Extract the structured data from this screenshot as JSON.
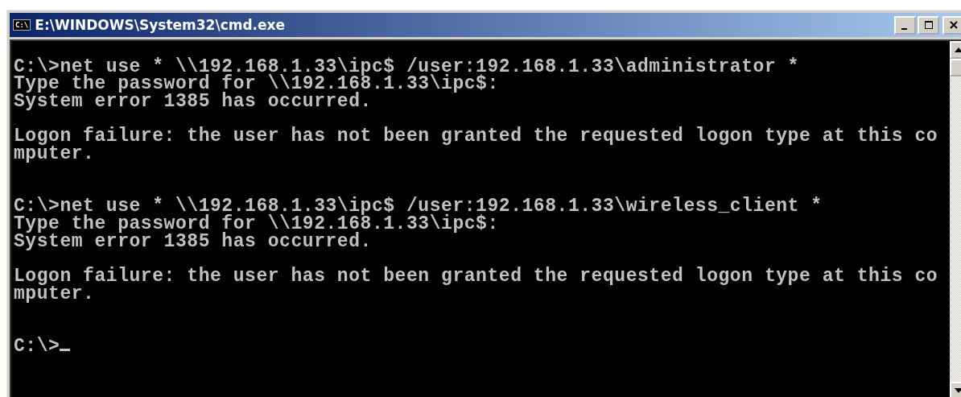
{
  "window": {
    "title": "E:\\WINDOWS\\System32\\cmd.exe",
    "icon_text": "C:\\"
  },
  "console": {
    "blocks": [
      {
        "kind": "command",
        "lines": [
          "C:\\>net use * \\\\192.168.1.33\\ipc$ /user:192.168.1.33\\administrator *",
          "Type the password for \\\\192.168.1.33\\ipc$:",
          "System error 1385 has occurred."
        ]
      },
      {
        "kind": "message",
        "lines": [
          "Logon failure: the user has not been granted the requested logon type at this co",
          "mputer."
        ]
      },
      {
        "kind": "command",
        "lines": [
          "C:\\>net use * \\\\192.168.1.33\\ipc$ /user:192.168.1.33\\wireless_client *",
          "Type the password for \\\\192.168.1.33\\ipc$:",
          "System error 1385 has occurred."
        ]
      },
      {
        "kind": "message",
        "lines": [
          "Logon failure: the user has not been granted the requested logon type at this co",
          "mputer."
        ]
      },
      {
        "kind": "prompt",
        "lines": [
          "C:\\>"
        ]
      }
    ]
  }
}
